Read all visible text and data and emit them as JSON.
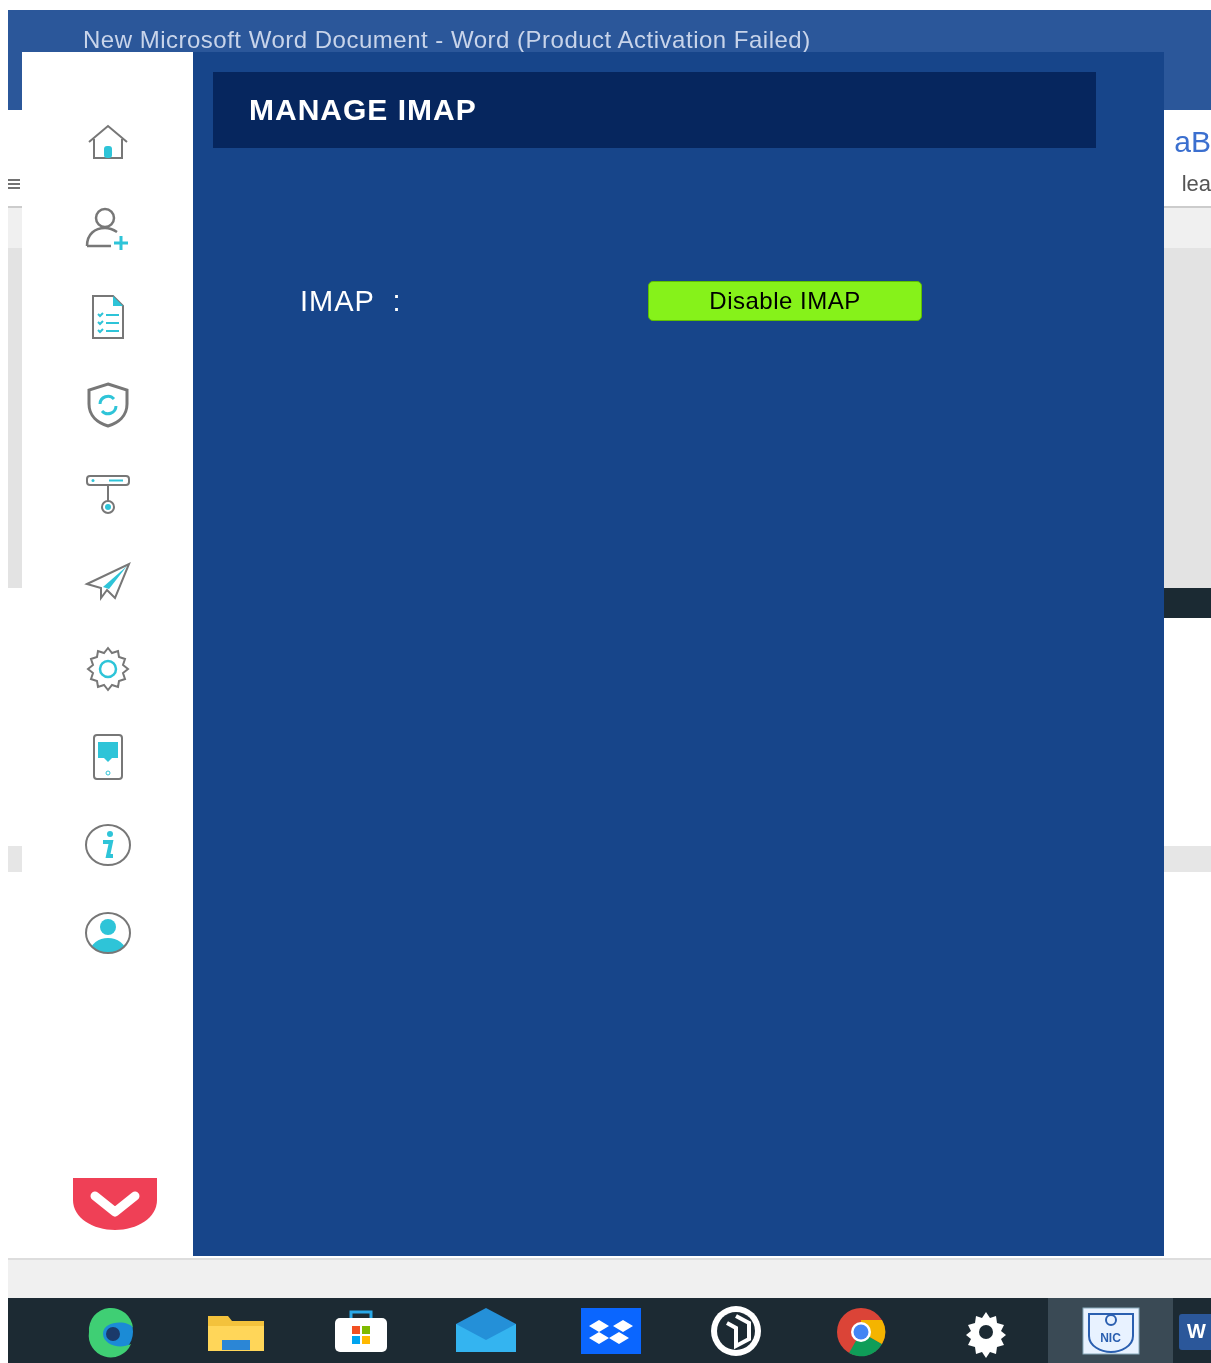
{
  "background_window": {
    "title": "New Microsoft Word Document - Word (Product Activation Failed)",
    "ribbon_texts": [
      "aB",
      "lea"
    ]
  },
  "app": {
    "sidebar": {
      "items": [
        {
          "kind": "home"
        },
        {
          "kind": "add-user"
        },
        {
          "kind": "document"
        },
        {
          "kind": "shield"
        },
        {
          "kind": "server"
        },
        {
          "kind": "send"
        },
        {
          "kind": "settings"
        },
        {
          "kind": "phone"
        },
        {
          "kind": "info"
        },
        {
          "kind": "user"
        }
      ]
    },
    "header": "MANAGE IMAP",
    "field_label": "IMAP  :",
    "button": "Disable IMAP"
  },
  "taskbar": {
    "items": [
      {
        "kind": "edge",
        "selected": false
      },
      {
        "kind": "folder",
        "selected": false
      },
      {
        "kind": "store",
        "selected": false
      },
      {
        "kind": "mail",
        "selected": false
      },
      {
        "kind": "dropbox",
        "selected": false
      },
      {
        "kind": "hexagon",
        "selected": false
      },
      {
        "kind": "chrome",
        "selected": false
      },
      {
        "kind": "gear",
        "selected": false
      },
      {
        "kind": "nic",
        "selected": true,
        "label": "NIC"
      },
      {
        "kind": "word",
        "selected": false,
        "label": "W"
      }
    ]
  }
}
